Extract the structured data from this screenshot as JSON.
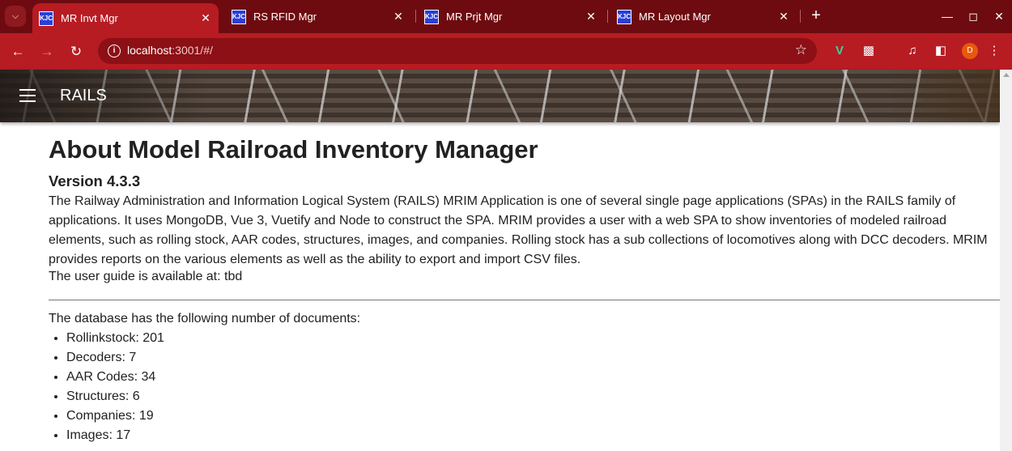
{
  "browser": {
    "tabs": [
      {
        "favicon": "KJC",
        "title": "MR Invt Mgr",
        "active": true
      },
      {
        "favicon": "KJC",
        "title": "RS RFID Mgr",
        "active": false
      },
      {
        "favicon": "KJC",
        "title": "MR Prjt Mgr",
        "active": false
      },
      {
        "favicon": "KJC",
        "title": "MR Layout Mgr",
        "active": false
      }
    ],
    "url_host": "localhost",
    "url_rest": ":3001/#/",
    "profile_initial": "D",
    "colors": {
      "tabstrip": "#6e0b10",
      "toolbar": "#b71c23",
      "omnibox": "#8c1015",
      "avatar": "#e8590c"
    }
  },
  "app": {
    "title": "RAILS"
  },
  "page": {
    "heading": "About Model Railroad Inventory Manager",
    "version": "Version 4.3.3",
    "description": "The Railway Administration and Information Logical System (RAILS) MRIM Application is one of several single page applications (SPAs) in the RAILS family of applications. It uses MongoDB, Vue 3, Vuetify and Node to construct the SPA. MRIM provides a user with a web SPA to show inventories of modeled railroad elements, such as rolling stock, AAR codes, structures, images, and companies. Rolling stock has a sub collections of locomotives along with DCC decoders. MRIM provides reports on the various elements as well as the ability to export and import CSV files.",
    "user_guide": "The user guide is available at: tbd",
    "db_intro": "The database has the following number of documents:",
    "counts": [
      "Rollinkstock: 201",
      "Decoders: 7",
      "AAR Codes: 34",
      "Structures: 6",
      "Companies: 19",
      "Images: 17"
    ]
  }
}
